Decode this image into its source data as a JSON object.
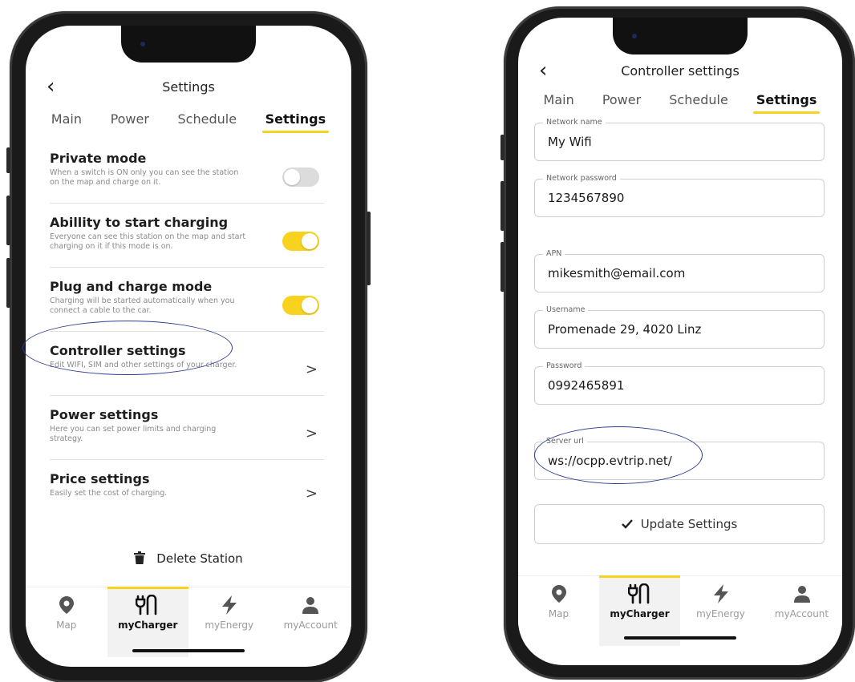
{
  "left": {
    "title": "Settings",
    "tabs": [
      "Main",
      "Power",
      "Schedule",
      "Settings"
    ],
    "rows": [
      {
        "title": "Private mode",
        "desc": "When a switch is ON only you can see the station on the map and charge on it.",
        "control": "toggle-off"
      },
      {
        "title": "Abillity to start charging",
        "desc": "Everyone can see this station on the map and start charging on it if this mode is on.",
        "control": "toggle-on"
      },
      {
        "title": "Plug and charge mode",
        "desc": "Charging will be started automatically when you connect a cable to the car.",
        "control": "toggle-on"
      },
      {
        "title": "Controller settings",
        "desc": "Edit WIFI, SIM and other settings of your charger.",
        "control": "chevron"
      },
      {
        "title": "Power settings",
        "desc": "Here you can set power limits and charging strategy.",
        "control": "chevron"
      },
      {
        "title": "Price settings",
        "desc": "Easily set the cost of charging.",
        "control": "chevron"
      }
    ],
    "delete_label": "Delete Station"
  },
  "right": {
    "title": "Controller settings",
    "tabs": [
      "Main",
      "Power",
      "Schedule",
      "Settings"
    ],
    "fields": [
      {
        "label": "Network name",
        "value": "My Wifi"
      },
      {
        "label": "Network password",
        "value": "1234567890"
      },
      {
        "label": "APN",
        "value": "mikesmith@email.com"
      },
      {
        "label": "Username",
        "value": "Promenade 29, 4020 Linz"
      },
      {
        "label": "Password",
        "value": "0992465891"
      },
      {
        "label": "Server url",
        "value": "ws://ocpp.evtrip.net/"
      }
    ],
    "update_label": "Update Settings"
  },
  "nav": [
    "Map",
    "myCharger",
    "myEnergy",
    "myAccount"
  ],
  "icons": {
    "back": "back-chevron-icon",
    "chevron": "chevron-right-icon",
    "trash": "trash-icon",
    "check": "check-icon",
    "map": "map-pin-icon",
    "charger": "plug-icon",
    "energy": "lightning-icon",
    "account": "user-icon"
  },
  "colors": {
    "accent": "#f7d21e",
    "annotation": "#2c3b8f"
  }
}
